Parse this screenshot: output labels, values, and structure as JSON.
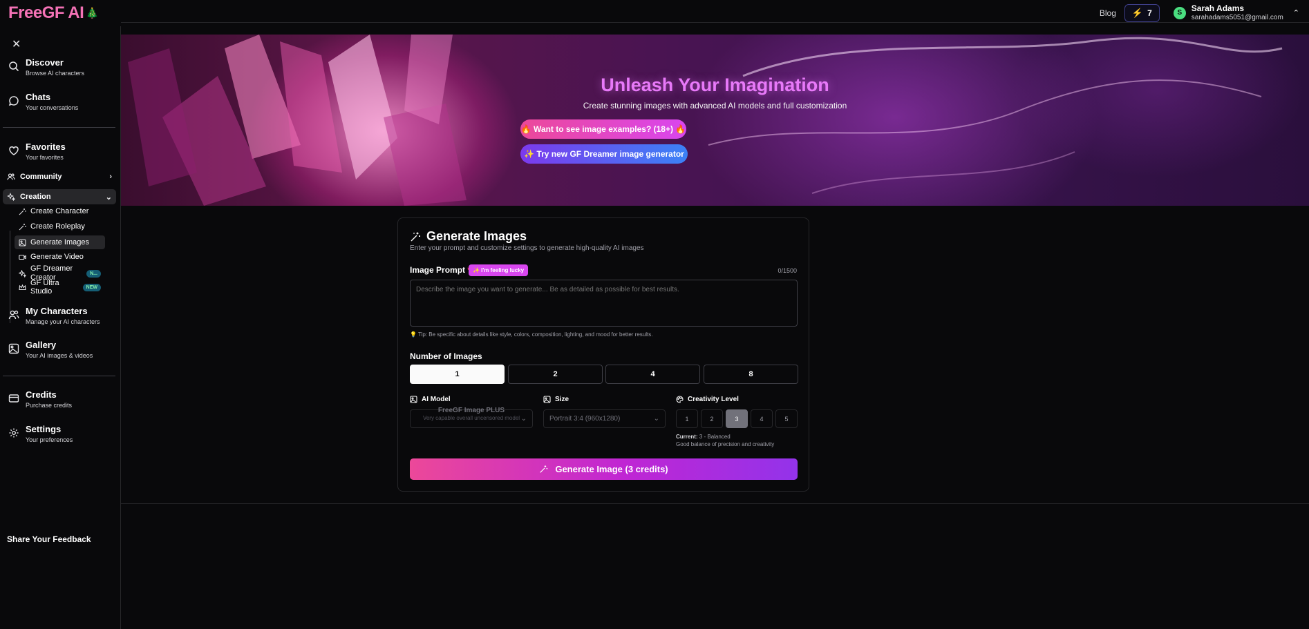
{
  "header": {
    "logo": "FreeGF AI",
    "logo_icon": "tree-icon",
    "blog": "Blog",
    "credits": "7",
    "user_initial": "S",
    "user_name": "Sarah Adams",
    "user_email": "sarahadams5051@gmail.com"
  },
  "sidebar": {
    "discover": {
      "title": "Discover",
      "subtitle": "Browse AI characters"
    },
    "chats": {
      "title": "Chats",
      "subtitle": "Your conversations"
    },
    "favorites": {
      "title": "Favorites",
      "subtitle": "Your favorites"
    },
    "community": "Community",
    "creation": "Creation",
    "creation_items": [
      {
        "label": "Create Character",
        "icon": "wand-icon"
      },
      {
        "label": "Create Roleplay",
        "icon": "wand-icon"
      },
      {
        "label": "Generate Images",
        "icon": "image-icon"
      },
      {
        "label": "Generate Video",
        "icon": "video-icon"
      },
      {
        "label": "GF Dreamer Creator",
        "icon": "sparkles-icon",
        "badge": "N..."
      },
      {
        "label": "GF Ultra Studio",
        "icon": "crown-icon",
        "badge": "NEW"
      }
    ],
    "my_characters": {
      "title": "My Characters",
      "subtitle": "Manage your AI characters"
    },
    "gallery": {
      "title": "Gallery",
      "subtitle": "Your AI images & videos"
    },
    "credits": {
      "title": "Credits",
      "subtitle": "Purchase credits"
    },
    "settings": {
      "title": "Settings",
      "subtitle": "Your preferences"
    },
    "feedback": "Share Your Feedback"
  },
  "hero": {
    "title": "Unleash Your Imagination",
    "subtitle": "Create stunning images with advanced AI models and full customization",
    "examples_button": "🔥 Want to see image examples? (18+) 🔥",
    "dreamer_button": "✨ Try new GF Dreamer image generator"
  },
  "generator": {
    "title": "Generate Images",
    "subtitle": "Enter your prompt and customize settings to generate high-quality AI images",
    "prompt_label": "Image Prompt",
    "required_mark": "*",
    "lucky_button": "✨ I'm feeling lucky",
    "counter": "0/1500",
    "prompt_placeholder": "Describe the image you want to generate... Be as detailed as possible for best results.",
    "prompt_value": "",
    "tip": "💡 Tip: Be specific about details like style, colors, composition, lighting, and mood for better results.",
    "num_images_label": "Number of Images",
    "num_options": [
      "1",
      "2",
      "4",
      "8"
    ],
    "num_selected": "1",
    "model_label": "AI Model",
    "model_name": "FreeGF Image PLUS",
    "model_desc": "Very capable overall uncensored model",
    "size_label": "Size",
    "size_value": "Portrait 3:4 (960x1280)",
    "creativity_label": "Creativity Level",
    "creativity_options": [
      "1",
      "2",
      "3",
      "4",
      "5"
    ],
    "creativity_selected": "3",
    "current_prefix": "Current:",
    "current_value": "3 - Balanced",
    "current_desc": "Good balance of precision and creativity",
    "generate_button": "Generate Image (3 credits)"
  },
  "colors": {
    "accent_pink": "#ec4899",
    "accent_purple": "#9333ea",
    "background": "#09090b"
  }
}
